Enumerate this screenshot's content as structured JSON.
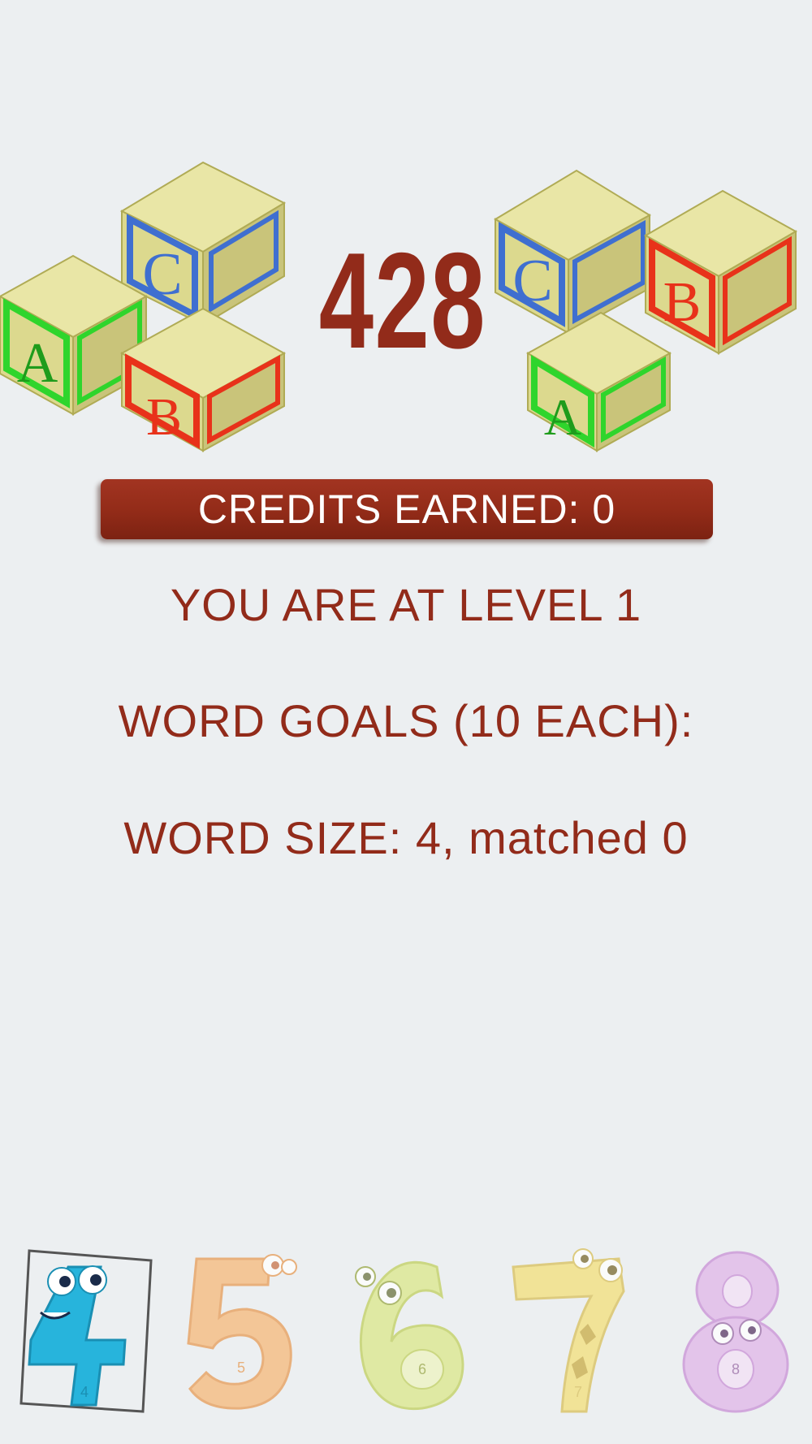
{
  "score": "428",
  "credits": {
    "label": "CREDITS EARNED: 0"
  },
  "level_text": "YOU ARE AT LEVEL 1",
  "goals_text": "WORD GOALS (10 EACH):",
  "word_size_text": "WORD SIZE: 4, matched 0",
  "blocks_left": {
    "letters": [
      "A",
      "C",
      "B"
    ]
  },
  "blocks_right": {
    "letters": [
      "C",
      "B",
      "A"
    ]
  },
  "word_sizes": [
    {
      "digit": "4",
      "selected": true,
      "color": "#27b4dc"
    },
    {
      "digit": "5",
      "selected": false,
      "color": "#f6b97a"
    },
    {
      "digit": "6",
      "selected": false,
      "color": "#dbe88a"
    },
    {
      "digit": "7",
      "selected": false,
      "color": "#f3df7a"
    },
    {
      "digit": "8",
      "selected": false,
      "color": "#e0b6e8"
    }
  ],
  "colors": {
    "accent": "#922b1a",
    "background": "#eceff1",
    "block_face": "#dcd98e",
    "block_green": "#2fd52c",
    "block_blue": "#3f6fd0",
    "block_red": "#e8321a"
  }
}
